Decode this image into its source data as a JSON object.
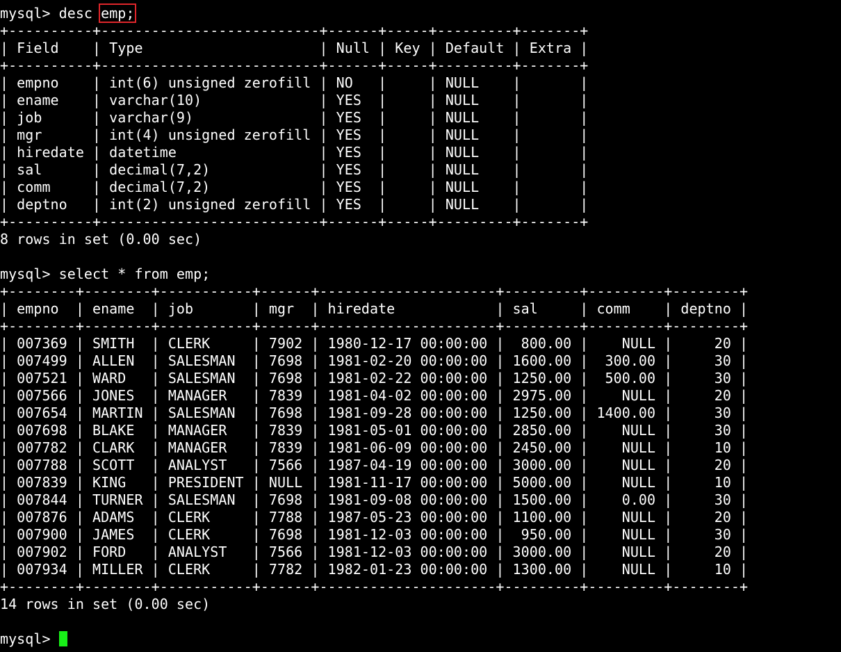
{
  "terminal": {
    "prompt": "mysql> ",
    "colors": {
      "background": "#000000",
      "foreground": "#ffffff",
      "highlight_border": "#e0262b",
      "cursor": "#18f018"
    },
    "desc": {
      "command_prefix": "desc ",
      "command_highlight": "emp;",
      "border": "+----------+--------------------------+------+-----+---------+-------+",
      "header": "| Field    | Type                     | Null | Key | Default | Extra |",
      "rows": [
        "| empno    | int(6) unsigned zerofill | NO   |     | NULL    |       |",
        "| ename    | varchar(10)              | YES  |     | NULL    |       |",
        "| job      | varchar(9)               | YES  |     | NULL    |       |",
        "| mgr      | int(4) unsigned zerofill | YES  |     | NULL    |       |",
        "| hiredate | datetime                 | YES  |     | NULL    |       |",
        "| sal      | decimal(7,2)             | YES  |     | NULL    |       |",
        "| comm     | decimal(7,2)             | YES  |     | NULL    |       |",
        "| deptno   | int(2) unsigned zerofill | YES  |     | NULL    |       |"
      ],
      "summary": "8 rows in set (0.00 sec)"
    },
    "select": {
      "command": "select * from emp;",
      "border": "+--------+--------+-----------+------+---------------------+---------+---------+--------+",
      "header": "| empno  | ename  | job       | mgr  | hiredate            | sal     | comm    | deptno |",
      "rows": [
        "| 007369 | SMITH  | CLERK     | 7902 | 1980-12-17 00:00:00 |  800.00 |    NULL |     20 |",
        "| 007499 | ALLEN  | SALESMAN  | 7698 | 1981-02-20 00:00:00 | 1600.00 |  300.00 |     30 |",
        "| 007521 | WARD   | SALESMAN  | 7698 | 1981-02-22 00:00:00 | 1250.00 |  500.00 |     30 |",
        "| 007566 | JONES  | MANAGER   | 7839 | 1981-04-02 00:00:00 | 2975.00 |    NULL |     20 |",
        "| 007654 | MARTIN | SALESMAN  | 7698 | 1981-09-28 00:00:00 | 1250.00 | 1400.00 |     30 |",
        "| 007698 | BLAKE  | MANAGER   | 7839 | 1981-05-01 00:00:00 | 2850.00 |    NULL |     30 |",
        "| 007782 | CLARK  | MANAGER   | 7839 | 1981-06-09 00:00:00 | 2450.00 |    NULL |     10 |",
        "| 007788 | SCOTT  | ANALYST   | 7566 | 1987-04-19 00:00:00 | 3000.00 |    NULL |     20 |",
        "| 007839 | KING   | PRESIDENT | NULL | 1981-11-17 00:00:00 | 5000.00 |    NULL |     10 |",
        "| 007844 | TURNER | SALESMAN  | 7698 | 1981-09-08 00:00:00 | 1500.00 |    0.00 |     30 |",
        "| 007876 | ADAMS  | CLERK     | 7788 | 1987-05-23 00:00:00 | 1100.00 |    NULL |     20 |",
        "| 007900 | JAMES  | CLERK     | 7698 | 1981-12-03 00:00:00 |  950.00 |    NULL |     30 |",
        "| 007902 | FORD   | ANALYST   | 7566 | 1981-12-03 00:00:00 | 3000.00 |    NULL |     20 |",
        "| 007934 | MILLER | CLERK     | 7782 | 1982-01-23 00:00:00 | 1300.00 |    NULL |     10 |"
      ],
      "summary": "14 rows in set (0.00 sec)"
    }
  }
}
